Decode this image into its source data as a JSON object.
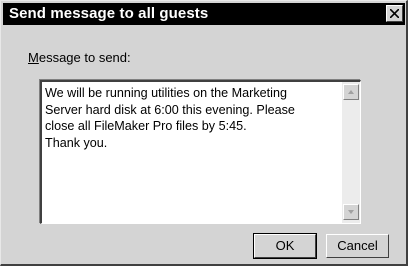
{
  "window": {
    "title": "Send message to all guests"
  },
  "form": {
    "label_accel": "M",
    "label_rest": "essage to send:",
    "message": "We will be running utilities on the Marketing Server hard disk at 6:00 this evening.  Please close all FileMaker Pro files by 5:45.\nThank you."
  },
  "buttons": {
    "ok": "OK",
    "cancel": "Cancel"
  },
  "icons": {
    "close": "close-x-icon",
    "scroll_up": "triangle-up-icon",
    "scroll_down": "triangle-down-icon"
  },
  "colors": {
    "title_bar": "#000000",
    "dialog_bg": "#d4d4d4"
  }
}
